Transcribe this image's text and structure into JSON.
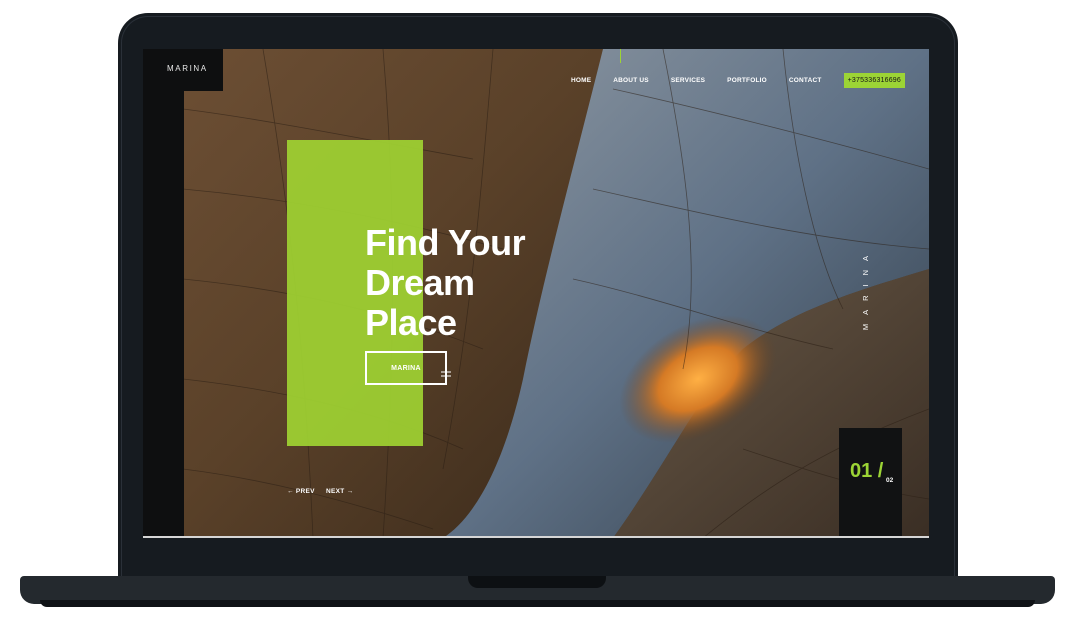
{
  "brand": "MARINA",
  "nav": {
    "items": [
      "HOME",
      "ABOUT US",
      "SERVICES",
      "PORTFOLIO",
      "CONTACT"
    ],
    "phone": "+375336316696"
  },
  "hero": {
    "headline_lines": [
      "Find Your",
      "Dream",
      "Place"
    ],
    "cta_label": "MARINA"
  },
  "slider": {
    "prev_label": "← PREV",
    "next_label": "NEXT →",
    "current": "01 /",
    "total": "02"
  },
  "vertical_brand": "MARINA",
  "colors": {
    "accent": "#9cd435",
    "dark": "#0e0f10",
    "laptop": "#161b20"
  }
}
